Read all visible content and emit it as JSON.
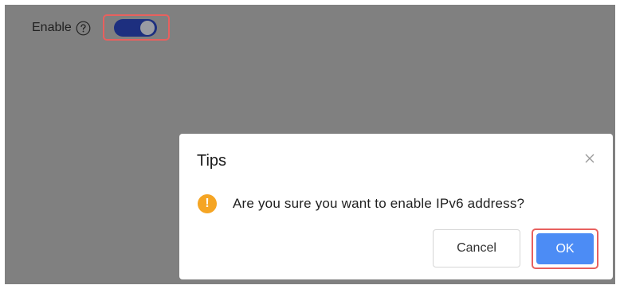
{
  "colors": {
    "overlay": "#808080",
    "toggle_track": "#1d2f7f",
    "toggle_knob": "#9a9ca3",
    "highlight": "#e8605e",
    "primary": "#4c8cf5",
    "warning": "#f5a524"
  },
  "settings": {
    "enable_label": "Enable",
    "help_icon": "question-circle-icon",
    "toggle_state": "on"
  },
  "dialog": {
    "title": "Tips",
    "close_icon": "close-icon",
    "warning_icon": "exclamation-circle-icon",
    "warning_glyph": "!",
    "message": "Are you sure you want to enable IPv6 address?",
    "cancel_label": "Cancel",
    "ok_label": "OK"
  }
}
